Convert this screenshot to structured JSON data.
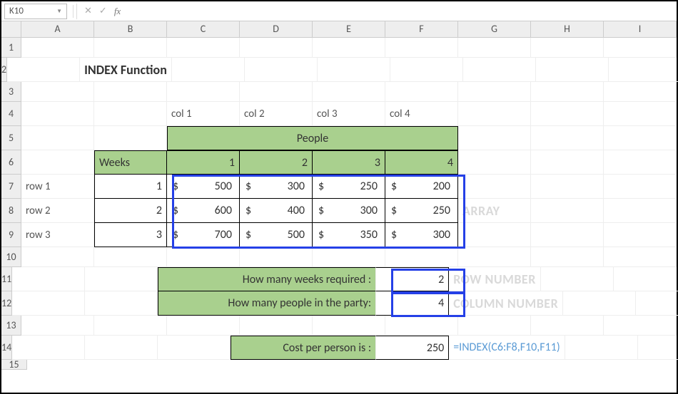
{
  "namebox": {
    "value": "K10"
  },
  "formula_bar": {
    "value": ""
  },
  "col_headers": [
    "A",
    "B",
    "C",
    "D",
    "E",
    "F",
    "G",
    "H",
    "I"
  ],
  "row_headers": [
    "1",
    "2",
    "3",
    "4",
    "5",
    "6",
    "7",
    "8",
    "9",
    "10",
    "11",
    "12",
    "13",
    "14",
    "15"
  ],
  "title": "INDEX Function",
  "col_labels": [
    "col 1",
    "col 2",
    "col 3",
    "col 4"
  ],
  "people_header": "People",
  "weeks_header": "Weeks",
  "col_nums": [
    "1",
    "2",
    "3",
    "4"
  ],
  "row_labels": [
    "row 1",
    "row 2",
    "row 3"
  ],
  "week_nums": [
    "1",
    "2",
    "3"
  ],
  "table": [
    [
      "500",
      "300",
      "250",
      "200"
    ],
    [
      "600",
      "400",
      "300",
      "250"
    ],
    [
      "700",
      "500",
      "350",
      "300"
    ]
  ],
  "q1": {
    "label": "How many weeks required :",
    "value": "2"
  },
  "q2": {
    "label": "How many people in the party:",
    "value": "4"
  },
  "cost": {
    "label": "Cost per person is :",
    "value": "250",
    "formula": "=INDEX(C6:F8,F10,F11)"
  },
  "annot": {
    "array": "ARRAY",
    "row": "ROW NUMBER",
    "col": "COLUMN NUMBER"
  },
  "currency": "$"
}
